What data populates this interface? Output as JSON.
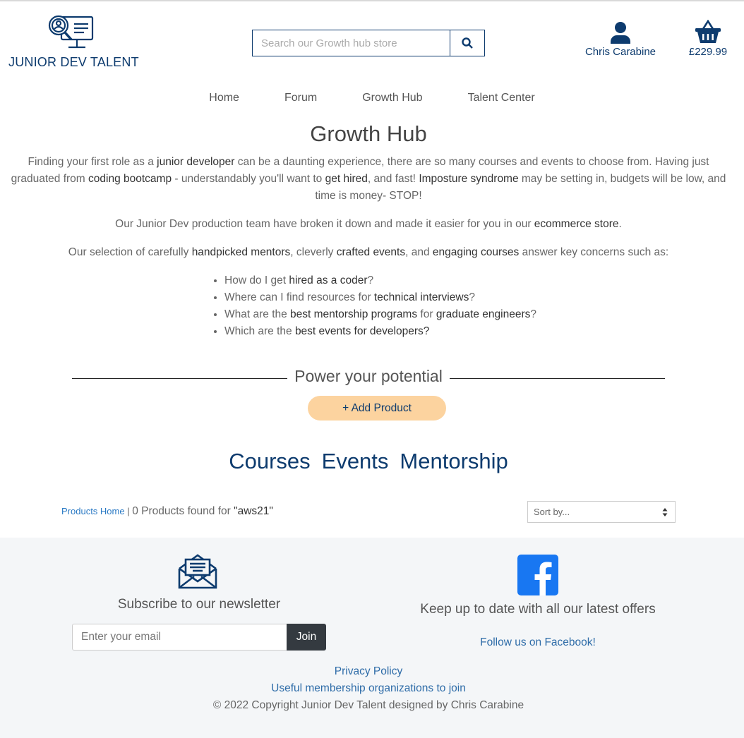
{
  "brand": {
    "name": "JUNIOR DEV TALENT",
    "logo_icon": "monitor-magnifier-icon",
    "color": "#0d3b6e"
  },
  "search": {
    "placeholder": "Search our Growth hub store",
    "icon": "search-icon"
  },
  "account": {
    "label": "Chris Carabine",
    "icon": "user-icon"
  },
  "cart": {
    "total": "£229.99",
    "icon": "basket-icon"
  },
  "nav": [
    "Home",
    "Forum",
    "Growth Hub",
    "Talent Center"
  ],
  "intro": {
    "title": "Growth Hub",
    "p1": [
      "Finding your first role as a ",
      "junior developer",
      " can be a daunting experience, there are so many courses and events to choose from. Having just graduated from ",
      "coding bootcamp",
      " - understandably you'll want to ",
      "get hired",
      ", and fast! ",
      "Imposture syndrome",
      " may be setting in, budgets will be low, and time is money- STOP!"
    ],
    "p2": [
      "Our Junior Dev production team have broken it down and made it easier for you in our ",
      "ecommerce store",
      "."
    ],
    "p3": [
      "Our selection of carefully ",
      "handpicked mentors",
      ", cleverly ",
      "crafted events",
      ", and ",
      "engaging courses",
      " answer key concerns such as:"
    ],
    "concerns": [
      [
        "How do I get ",
        "hired as a coder",
        "?"
      ],
      [
        "Where can I find resources for ",
        "technical interviews",
        "?"
      ],
      [
        "What are the ",
        "best mentorship programs",
        " for ",
        "graduate engineers",
        "?"
      ],
      [
        "Which are the ",
        "best events for developers?"
      ]
    ]
  },
  "section": {
    "divider_title": "Power your potential",
    "add_button": "+ Add Product",
    "add_button_color": "#fcd39f",
    "categories": [
      "Courses",
      "Events",
      "Mentorship"
    ]
  },
  "results": {
    "home_link": "Products Home",
    "separator": " | ",
    "count_text": "0 Products found for ",
    "query": "\"aws21\"",
    "sort_label": "Sort by..."
  },
  "footer": {
    "newsletter_icon": "envelope-open-icon",
    "newsletter_title": "Subscribe to our newsletter",
    "email_placeholder": "Enter your email",
    "join_label": "Join",
    "facebook_icon": "facebook-icon",
    "facebook_color": "#1877f2",
    "offers_title": "Keep up to date with all our latest offers",
    "facebook_link": "Follow us on Facebook!",
    "privacy": "Privacy Policy",
    "membership": "Useful membership organizations to join",
    "copyright": "© 2022 Copyright Junior Dev Talent designed by Chris Carabine"
  }
}
